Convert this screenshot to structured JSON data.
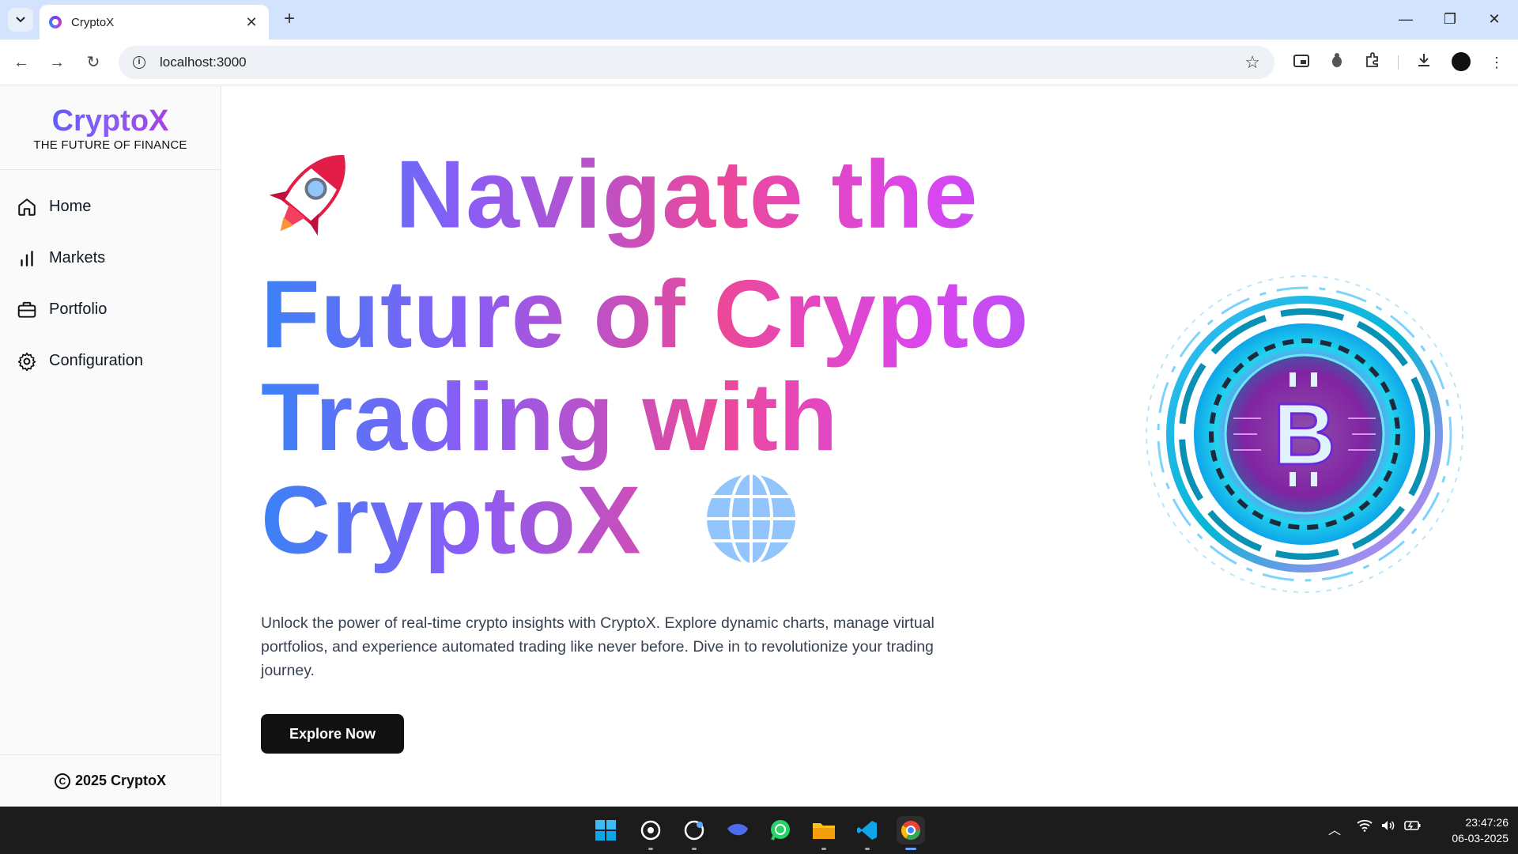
{
  "browser": {
    "tab_title": "CryptoX",
    "url": "localhost:3000"
  },
  "sidebar": {
    "brand_name": "CryptoX",
    "brand_tagline": "THE FUTURE OF FINANCE",
    "items": [
      {
        "label": "Home",
        "icon": "home-icon"
      },
      {
        "label": "Markets",
        "icon": "bar-chart-icon"
      },
      {
        "label": "Portfolio",
        "icon": "briefcase-icon"
      },
      {
        "label": "Configuration",
        "icon": "gear-icon"
      }
    ],
    "footer": "2025 CryptoX"
  },
  "hero": {
    "line1": "Navigate the",
    "line2": "Future of Crypto",
    "line3": "Trading with",
    "line4": "CryptoX",
    "description": "Unlock the power of real-time crypto insights with CryptoX. Explore dynamic charts, manage virtual portfolios, and experience automated trading like never before. Dive in to revolutionize your trading journey.",
    "button_label": "Explore Now"
  },
  "taskbar": {
    "time": "23:47:26",
    "date": "06-03-2025"
  },
  "colors": {
    "gradient_start": "#3b82f6",
    "gradient_mid": "#ec4899",
    "gradient_end": "#a855f7",
    "button_bg": "#111111"
  }
}
